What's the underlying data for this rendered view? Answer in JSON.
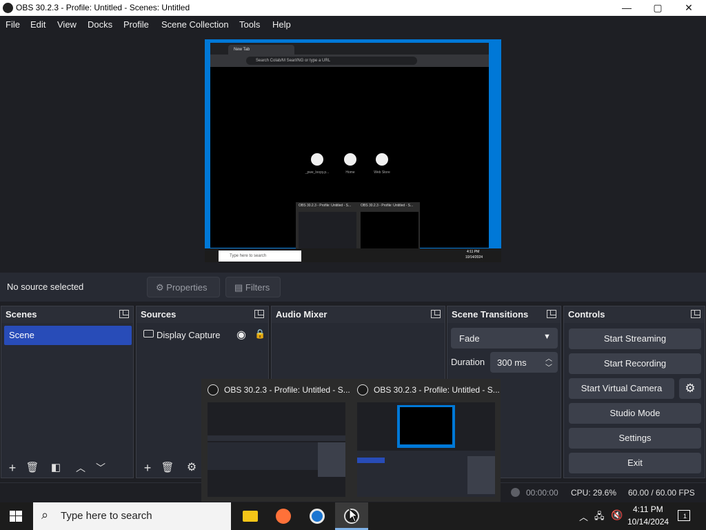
{
  "window": {
    "title": "OBS 30.2.3 - Profile: Untitled - Scenes: Untitled",
    "controls": {
      "minimize": "—",
      "maximize": "▢",
      "close": "✕"
    }
  },
  "menu": [
    "File",
    "Edit",
    "View",
    "Docks",
    "Profile",
    "Scene Collection",
    "Tools",
    "Help"
  ],
  "preview": {
    "browser_tab": "New Tab",
    "browser_url": "Search Colab/M Searl/NG or type a URL",
    "shortcuts": [
      "_pwe_loopy.p...",
      "Home",
      "Web Store"
    ],
    "popup_titles": [
      "OBS 30.2.3 - Profile: Untitled - S...",
      "OBS 30.2.3 - Profile: Untitled - S..."
    ],
    "taskbar_search": "Type here to search",
    "clock_time": "4:11 PM",
    "clock_date": "10/14/2024"
  },
  "source_bar": {
    "no_source": "No source selected",
    "properties": "Properties",
    "filters": "Filters"
  },
  "docks": {
    "scenes": {
      "title": "Scenes",
      "items": [
        "Scene"
      ]
    },
    "sources": {
      "title": "Sources",
      "items": [
        "Display Capture"
      ]
    },
    "audio_mixer": {
      "title": "Audio Mixer"
    },
    "scene_transitions": {
      "title": "Scene Transitions",
      "transition": "Fade",
      "duration_label": "Duration",
      "duration_value": "300 ms"
    },
    "controls": {
      "title": "Controls",
      "start_streaming": "Start Streaming",
      "start_recording": "Start Recording",
      "start_virtual_camera": "Start Virtual Camera",
      "studio_mode": "Studio Mode",
      "settings": "Settings",
      "exit": "Exit"
    }
  },
  "thumbnails": [
    {
      "title": "OBS 30.2.3 - Profile: Untitled - S..."
    },
    {
      "title": "OBS 30.2.3 - Profile: Untitled - S..."
    }
  ],
  "status": {
    "rec_time": "00:00:00",
    "cpu": "CPU: 29.6%",
    "fps": "60.00 / 60.00 FPS"
  },
  "taskbar": {
    "search_placeholder": "Type here to search",
    "time": "4:11 PM",
    "date": "10/14/2024",
    "notification_count": "1"
  }
}
